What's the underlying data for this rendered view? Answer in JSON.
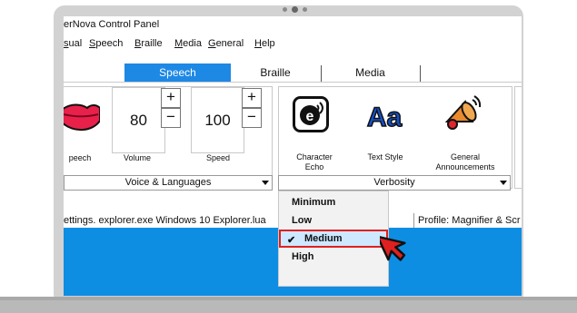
{
  "window": {
    "title": "erNova Control Panel"
  },
  "menubar": {
    "items": [
      {
        "prefix": "",
        "underline": "s",
        "rest": "ual",
        "full_hidden_prefix": ""
      },
      {
        "prefix": "",
        "underline": "S",
        "rest": "peech"
      },
      {
        "prefix": "",
        "underline": "B",
        "rest": "raille"
      },
      {
        "prefix": "",
        "underline": "M",
        "rest": "edia"
      },
      {
        "prefix": "",
        "underline": "G",
        "rest": "eneral"
      },
      {
        "prefix": "",
        "underline": "H",
        "rest": "elp"
      }
    ]
  },
  "tabs": {
    "speech": "Speech",
    "braille": "Braille",
    "media": "Media"
  },
  "speech_panel": {
    "volume_value": "80",
    "speed_value": "100",
    "plus": "+",
    "minus": "−",
    "labels": {
      "speech": "peech",
      "volume": "Volume",
      "speed": "Speed"
    },
    "dropdown": "Voice & Languages"
  },
  "verbosity_panel": {
    "labels": {
      "character_echo_line1": "Character",
      "character_echo_line2": "Echo",
      "text_style": "Text Style",
      "general_line1": "General",
      "general_line2": "Announcements"
    },
    "dropdown": "Verbosity",
    "icon_letter_e": "e",
    "icon_text_aa": "Aa"
  },
  "status": {
    "left": "ettings. explorer.exe Windows 10 Explorer.lua",
    "right": "Profile: Magnifier & Scr"
  },
  "verbosity_menu": {
    "options": [
      "Minimum",
      "Low",
      "Medium",
      "High"
    ],
    "selected": "Medium",
    "check": "✔"
  },
  "colors": {
    "accent": "#1e88e5",
    "desktop": "#0d8ee3",
    "highlight_border": "#e02020"
  }
}
